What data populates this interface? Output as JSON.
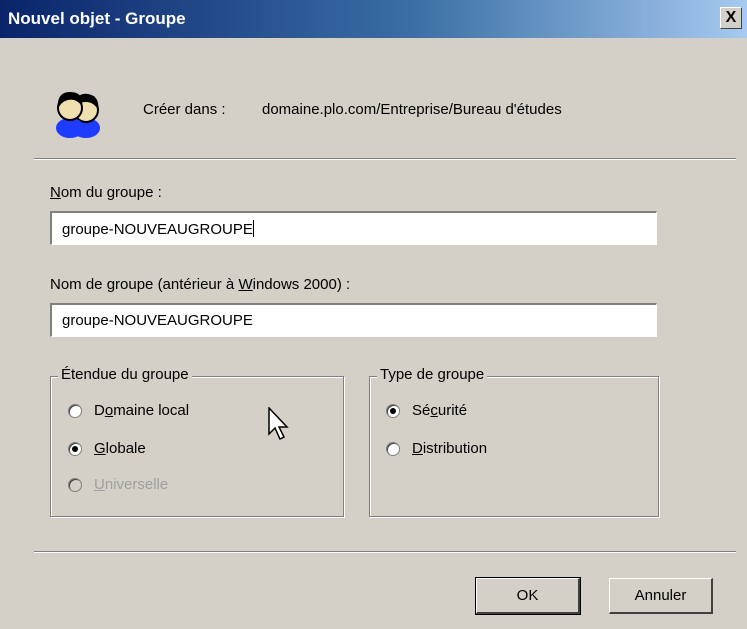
{
  "dialog": {
    "title": "Nouvel objet - Groupe",
    "close_label": "X"
  },
  "header": {
    "create_in_label": "Créer dans :",
    "create_in_path": "domaine.plo.com/Entreprise/Bureau d'études",
    "icon": "group-users-icon"
  },
  "group_name": {
    "label": "Nom du groupe :",
    "value": "groupe-NOUVEAUGROUPE"
  },
  "group_name_pre2000": {
    "label": "Nom de groupe (antérieur à Windows 2000) :",
    "value": "groupe-NOUVEAUGROUPE"
  },
  "scope": {
    "title": "Étendue du groupe",
    "options": [
      {
        "label": "Domaine local",
        "checked": false,
        "disabled": false
      },
      {
        "label": "Globale",
        "checked": true,
        "disabled": false
      },
      {
        "label": "Universelle",
        "checked": false,
        "disabled": true
      }
    ]
  },
  "type": {
    "title": "Type de groupe",
    "options": [
      {
        "label": "Sécurité",
        "checked": true
      },
      {
        "label": "Distribution",
        "checked": false
      }
    ]
  },
  "buttons": {
    "ok": "OK",
    "cancel": "Annuler"
  }
}
